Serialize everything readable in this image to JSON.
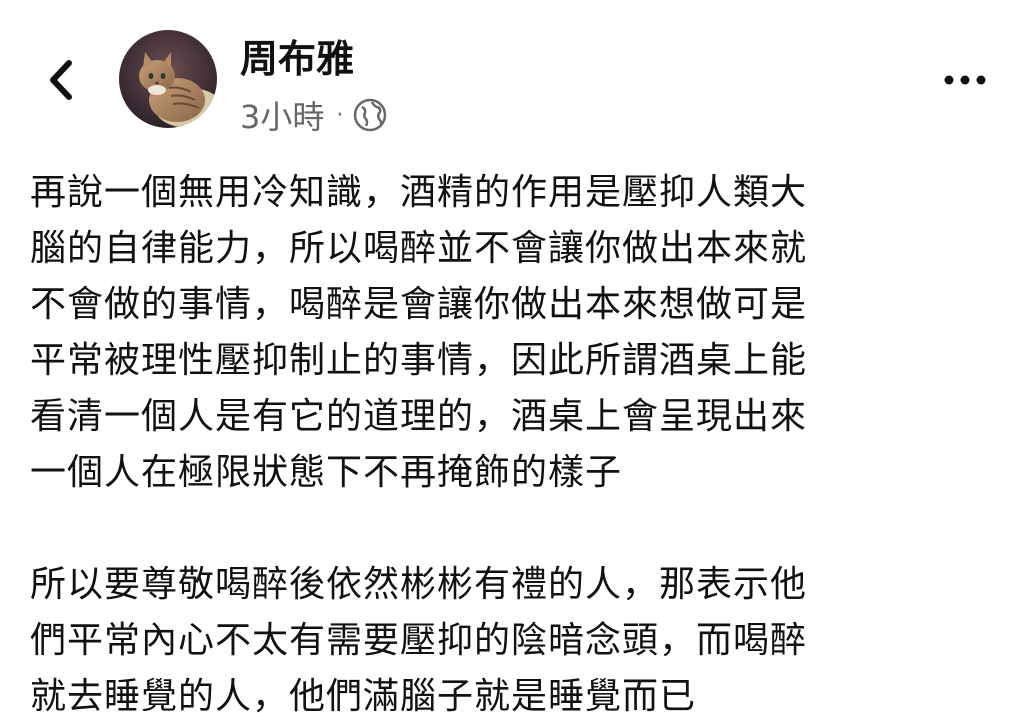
{
  "post": {
    "author_name": "周布雅",
    "time": "3小時",
    "separator": "·",
    "privacy_icon": "globe-icon",
    "back_icon": "chevron-left-icon",
    "more_icon": "more-dots-icon",
    "paragraphs": [
      {
        "lines": [
          "再說一個無用冷知識，酒精的作用是壓抑人類大",
          "腦的自律能力，所以喝醉並不會讓你做出本來就",
          "不會做的事情，喝醉是會讓你做出本來想做可是",
          "平常被理性壓抑制止的事情，因此所謂酒桌上能",
          "看清一個人是有它的道理的，酒桌上會呈現出來",
          "一個人在極限狀態下不再掩飾的樣子"
        ]
      },
      {
        "lines": [
          "所以要尊敬喝醉後依然彬彬有禮的人，那表示他",
          "們平常內心不太有需要壓抑的陰暗念頭，而喝醉",
          "就去睡覺的人，他們滿腦子就是睡覺而已"
        ]
      }
    ]
  },
  "colors": {
    "text": "#111111",
    "meta_text": "#65676b",
    "background": "#ffffff"
  }
}
